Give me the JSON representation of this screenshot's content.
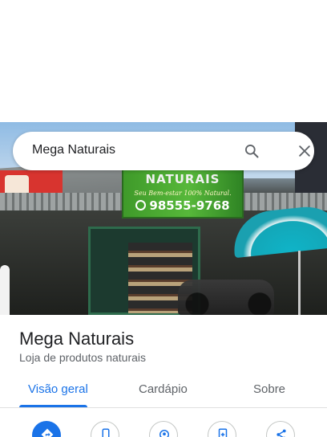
{
  "search": {
    "query": "Mega Naturais",
    "search_icon": "search-icon",
    "close_icon": "close-icon"
  },
  "photo": {
    "sign_title": "NATURAIS",
    "sign_subtitle": "Seu Bem-estar 100% Natural.",
    "sign_phone": "98555-9768"
  },
  "place": {
    "name": "Mega Naturais",
    "category": "Loja de produtos naturais"
  },
  "tabs": [
    {
      "label": "Visão geral",
      "active": true
    },
    {
      "label": "Cardápio",
      "active": false
    },
    {
      "label": "Sobre",
      "active": false
    }
  ],
  "actions": [
    {
      "icon": "directions-icon",
      "primary": true
    },
    {
      "icon": "phone-icon",
      "primary": false
    },
    {
      "icon": "location-icon",
      "primary": false
    },
    {
      "icon": "save-icon",
      "primary": false
    },
    {
      "icon": "share-icon",
      "primary": false
    }
  ],
  "colors": {
    "accent": "#1a73e8",
    "text_secondary": "#5f6368"
  }
}
